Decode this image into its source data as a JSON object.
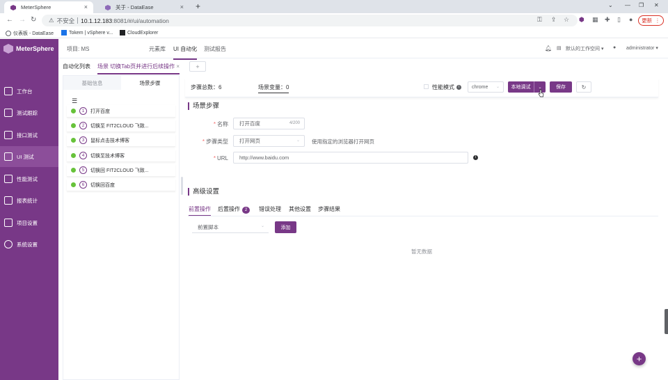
{
  "browser": {
    "tabs": [
      {
        "label": "MeterSphere",
        "active": true
      },
      {
        "label": "关于 - DataEase",
        "active": false
      }
    ],
    "address": {
      "security": "不安全",
      "host": "10.1.12.183",
      "path": ":8081/#/ui/automation"
    },
    "update_label": "更新",
    "bookmarks": [
      "仪表板 - DataEase",
      "Tokem | vSphere v...",
      "CloudExplorer"
    ]
  },
  "app": {
    "brand": "MeterSphere",
    "project": "项目: MS",
    "topnav": [
      "元素库",
      "UI 自动化",
      "测试报告"
    ],
    "workspace": "默认的工作空间",
    "user": "administrator"
  },
  "sidebar": {
    "items": [
      {
        "label": "工作台",
        "icon": "desktop-icon",
        "active": false
      },
      {
        "label": "测试跟踪",
        "icon": "track-icon",
        "active": false
      },
      {
        "label": "接口测试",
        "icon": "api-icon",
        "active": false
      },
      {
        "label": "UI 测试",
        "icon": "ui-icon",
        "active": true
      },
      {
        "label": "性能测试",
        "icon": "performance-icon",
        "active": false
      },
      {
        "label": "报表统计",
        "icon": "report-icon",
        "active": false
      },
      {
        "label": "项目设置",
        "icon": "project-icon",
        "active": false
      },
      {
        "label": "系统设置",
        "icon": "settings-icon",
        "active": false
      }
    ]
  },
  "subtabs": {
    "list": "自动化列表",
    "scenario": "场景 切换Tab页并进行后续操作",
    "add": "+"
  },
  "left": {
    "tabs": [
      "基础信息",
      "场景步骤"
    ],
    "steps": [
      {
        "n": "1",
        "label": "打开百度"
      },
      {
        "n": "2",
        "label": "切换至 FIT2CLOUD 飞致..."
      },
      {
        "n": "3",
        "label": "鼠标点击技术博客"
      },
      {
        "n": "4",
        "label": "切换至技术博客"
      },
      {
        "n": "5",
        "label": "切换回 FIT2CLOUD 飞致..."
      },
      {
        "n": "6",
        "label": "切换回百度"
      }
    ]
  },
  "toolbar": {
    "step_count": "步骤总数：6",
    "scene_vars": "场景变量：0",
    "perf_mode": "性能模式",
    "browser": "chrome",
    "run_label": "本地调试",
    "save_label": "保存"
  },
  "form": {
    "section_title": "场景步骤",
    "name_label": "名称",
    "name_value": "打开百度",
    "name_count": "4/200",
    "type_label": "步骤类型",
    "type_value": "打开网页",
    "type_hint": "使用指定的浏览器打开网页",
    "url_label": "URL",
    "url_value": "http://www.baidu.com"
  },
  "advanced": {
    "section_title": "高级设置",
    "tabs": [
      {
        "label": "前置操作",
        "active": true,
        "badge": ""
      },
      {
        "label": "后置操作",
        "active": false,
        "badge": "2"
      },
      {
        "label": "错误处理",
        "active": false,
        "badge": ""
      },
      {
        "label": "其他设置",
        "active": false,
        "badge": ""
      },
      {
        "label": "步骤结果",
        "active": false,
        "badge": ""
      }
    ],
    "script_select": "前置脚本",
    "add_label": "添加",
    "empty": "暂无数据"
  },
  "fab": "+",
  "colors": {
    "brand": "#783887",
    "success": "#67c23a"
  }
}
